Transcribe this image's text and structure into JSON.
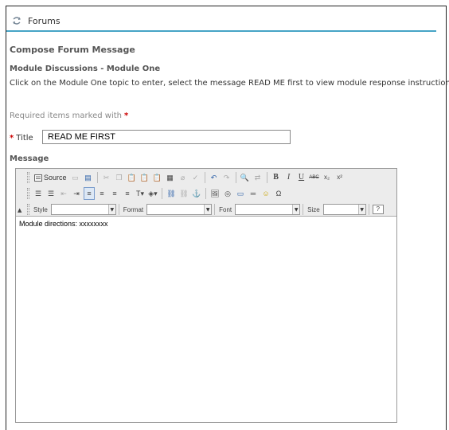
{
  "header": {
    "title": "Forums",
    "icon": "forums-icon"
  },
  "compose": {
    "title": "Compose Forum Message",
    "subtitle": "Module Discussions - Module One",
    "instructions": "Click on the Module One topic to enter, select the message READ ME first to view module response instructions."
  },
  "required_note": {
    "text": "Required items marked with",
    "star": "*"
  },
  "title_field": {
    "label": "Title",
    "star": "*",
    "value": "READ ME FIRST"
  },
  "message": {
    "label": "Message"
  },
  "toolbar": {
    "source_label": "Source",
    "style_label": "Style",
    "format_label": "Format",
    "font_label": "Font",
    "size_label": "Size",
    "bold": "B",
    "italic": "I",
    "underline": "U",
    "strike": "ABC",
    "sub": "x₂",
    "sup": "x²",
    "help": "?"
  },
  "editor": {
    "content": "Module directions: xxxxxxxx"
  },
  "colors": {
    "accent": "#46a4c6",
    "required": "#cc0000"
  }
}
